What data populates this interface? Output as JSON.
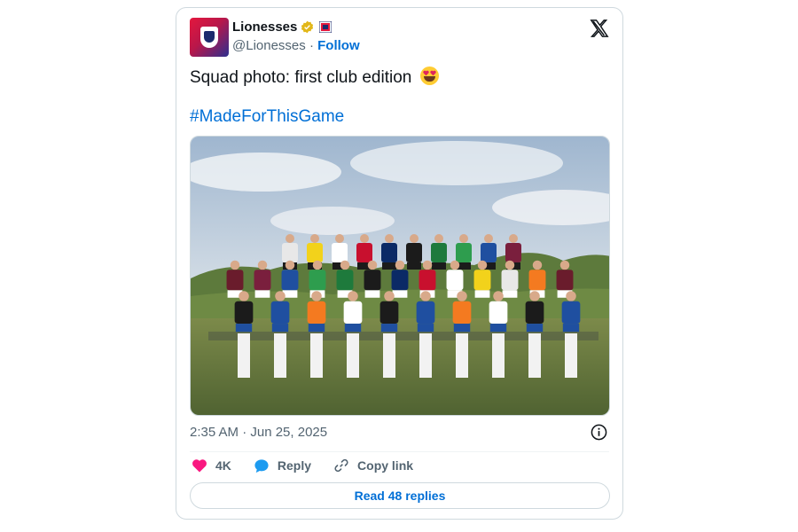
{
  "account": {
    "name": "Lionesses",
    "handle": "@Lionesses",
    "separator": "·",
    "follow_label": "Follow",
    "verified_icon": "verified-badge-gold",
    "affiliate_icon": "england-affiliate-badge"
  },
  "platform_icon": "x-logo",
  "tweet": {
    "text": "Squad photo: first club edition",
    "emoji": "smiling-face-with-heart-eyes",
    "hashtag": "#MadeForThisGame",
    "image_description": "Squad photo of players in club kits"
  },
  "timestamp": "2:35 AM · Jun 25, 2025",
  "actions": {
    "like_count": "4K",
    "reply_label": "Reply",
    "copy_link_label": "Copy link"
  },
  "read_replies_label": "Read 48 replies",
  "colors": {
    "link": "#006fd6",
    "muted": "#536471",
    "like": "#f91880",
    "reply": "#1d9bf0",
    "verified": "#e2b719"
  }
}
